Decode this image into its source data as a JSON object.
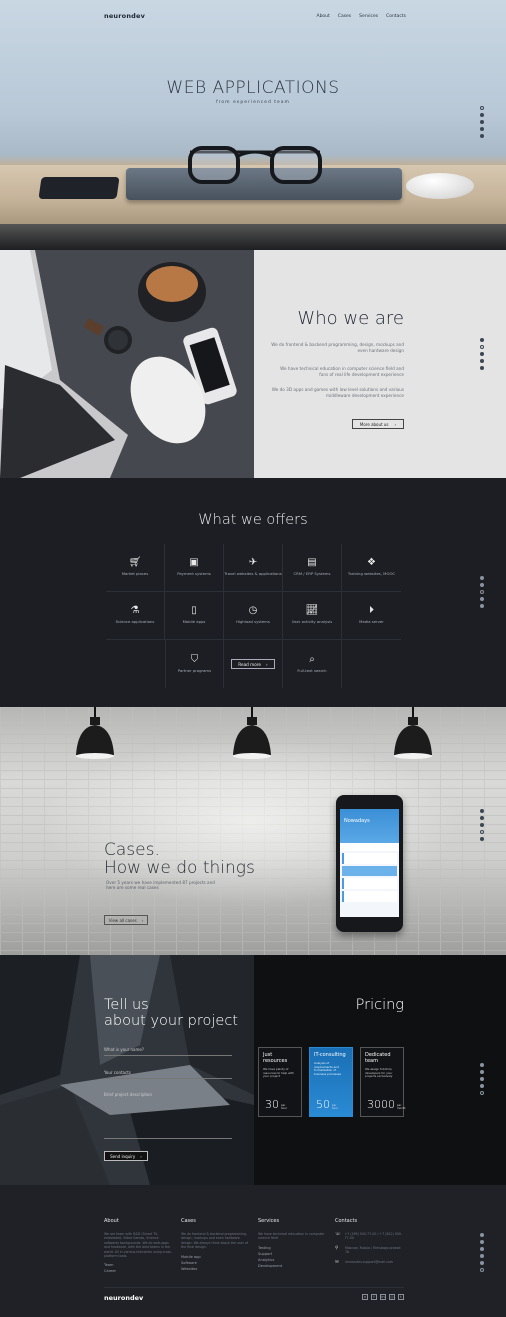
{
  "nav": {
    "brand": "neurondev",
    "items": [
      "About",
      "Cases",
      "Services",
      "Contacts"
    ]
  },
  "hero": {
    "title": "WEB APPLICATIONS",
    "subtitle": "from experienced team"
  },
  "who": {
    "title": "Who we are",
    "paragraphs": [
      "We do frontend & backend programming, design, mockups and even hardware design",
      "We have technical education in computer science field and fans of real life development experience",
      "We do 3D apps and games with low level solutions and various middleware development experience"
    ],
    "button": "More about us"
  },
  "offers": {
    "title": "What we offers",
    "items": [
      {
        "label": "Market places",
        "icon": "cart-icon"
      },
      {
        "label": "Payment systems",
        "icon": "money-icon"
      },
      {
        "label": "Travel websites & applications",
        "icon": "plane-icon"
      },
      {
        "label": "CRM / ERP Systems",
        "icon": "archive-icon"
      },
      {
        "label": "Training websites, MOOC",
        "icon": "cubes-icon"
      },
      {
        "label": "Science applications",
        "icon": "flask-icon"
      },
      {
        "label": "Mobile apps",
        "icon": "mobile-icon"
      },
      {
        "label": "Highload systems",
        "icon": "clock-icon"
      },
      {
        "label": "User activity analysis",
        "icon": "chart-icon"
      },
      {
        "label": "Media server",
        "icon": "play-icon"
      },
      {
        "label": "Partner programs",
        "icon": "shield-icon"
      },
      {
        "label": "Full-text search",
        "icon": "search-icon"
      }
    ],
    "button": "Read more"
  },
  "cases": {
    "title_line1": "Cases.",
    "title_line2": "How we do things",
    "text": "Over 5 years we have implemented 87 projects and here are some real cases",
    "button": "View all cases",
    "phone_screen_title": "Nowadays"
  },
  "project": {
    "title_line1": "Tell us",
    "title_line2": "about your project",
    "fields": [
      "What is your name?",
      "Your contacts",
      "Brief project description"
    ],
    "button": "Send inquiry"
  },
  "pricing": {
    "title": "Pricing",
    "cards": [
      {
        "name": "Just resources",
        "desc": "We have plenty of resources to help with your project",
        "price": "30",
        "unit_top": "per",
        "unit_bottom": "hour"
      },
      {
        "name": "IT-consulting",
        "desc": "Analysis of requirements and formalization of business processes",
        "price": "50",
        "unit_top": "per",
        "unit_bottom": "hour"
      },
      {
        "name": "Dedicated team",
        "desc": "We assign full-time developers for your projects exclusively",
        "price": "3000",
        "unit_top": "per",
        "unit_bottom": "month"
      }
    ]
  },
  "footer": {
    "about_title": "About",
    "about_text": "We are team with R&D (Smart TV, embedded, Video Games, Science software) backgrounds. We do web-apps and hardware, with the best teams in the world. All in various industries using cross-platform tools.",
    "about_links": [
      "Team",
      "Career"
    ],
    "cases_title": "Cases",
    "cases_text": "We do frontend & backend programming, design, mockups and even hardware design. We always think about the user of the final design.",
    "cases_links": [
      "Mobile app",
      "Software",
      "Websites"
    ],
    "services_title": "Services",
    "services_text": "We have technical education in computer science field",
    "services_links": [
      "Testing",
      "Support",
      "Analytics",
      "Development"
    ],
    "contacts_title": "Contacts",
    "phones": "+7 (495) 000-77-00 / +7 (812) 000-77-00",
    "address": "Moscow, Russia / Rimskogo proezd 7b",
    "email": "neurondev.support@mail.com",
    "brand": "neurondev",
    "social": [
      "vk-icon",
      "facebook-icon",
      "linkedin-icon",
      "instagram-icon",
      "twitter-icon"
    ]
  }
}
